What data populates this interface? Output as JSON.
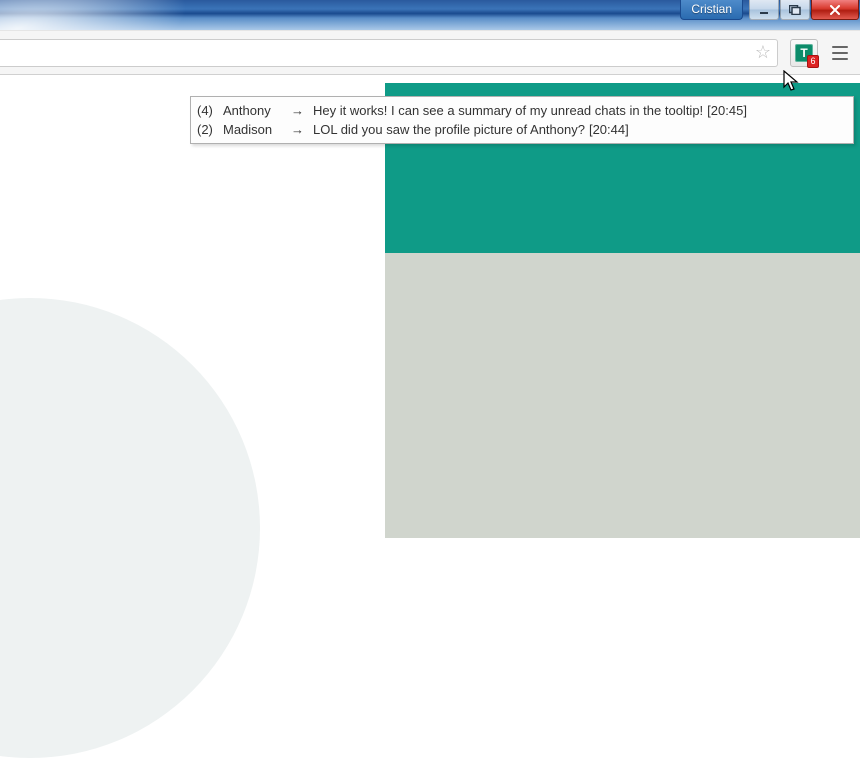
{
  "window": {
    "user_label": "Cristian"
  },
  "toolbar": {
    "star_title": "Bookmark this page",
    "ext_glyph": "T",
    "ext_badge": "6"
  },
  "tooltip": {
    "rows": [
      {
        "count": "(4)",
        "sender": "Anthony",
        "arrow": "→",
        "msg": "Hey it works! I can see a summary of my unread chats in the tooltip!",
        "time": "[20:45]"
      },
      {
        "count": "(2)",
        "sender": "Madison",
        "arrow": "→",
        "msg": "LOL did you saw the profile picture of Anthony?",
        "time": "[20:44]"
      }
    ]
  }
}
